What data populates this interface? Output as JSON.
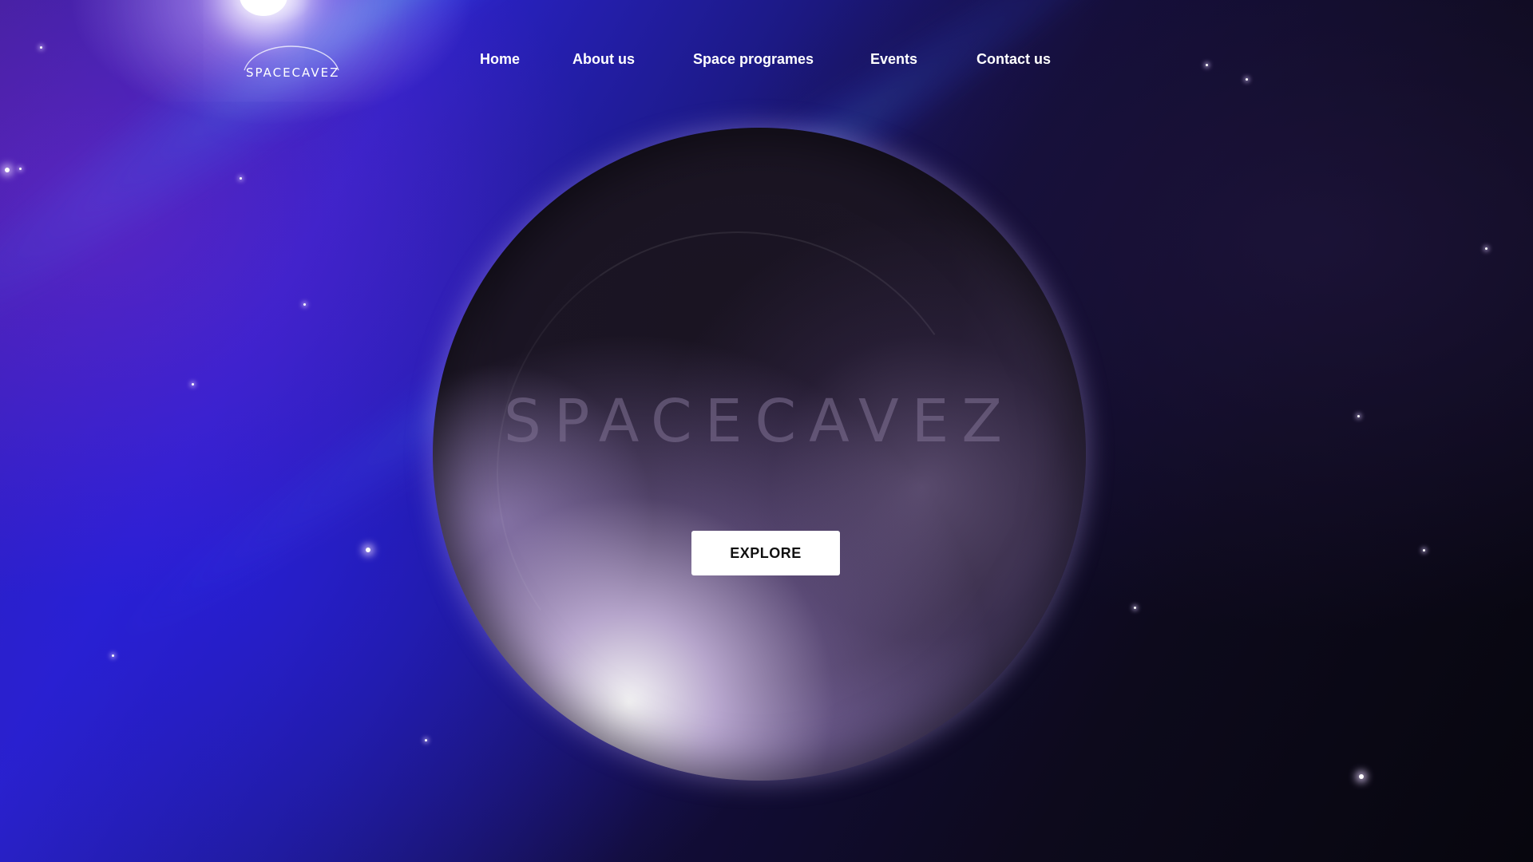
{
  "brand": {
    "logo_text": "SPACECAVEZ"
  },
  "nav": {
    "items": [
      {
        "label": "Home"
      },
      {
        "label": "About us"
      },
      {
        "label": "Space programes"
      },
      {
        "label": "Events"
      },
      {
        "label": "Contact us"
      }
    ]
  },
  "hero": {
    "title": "SPACECAVEZ",
    "cta_label": "EXPLORE"
  },
  "colors": {
    "background": "#0d0a1c",
    "nebula_blue": "#2a22c8",
    "nebula_purple": "#3a1f9a",
    "planet_highlight": "#e8ddff",
    "button_background": "#ffffff",
    "button_text": "#111111",
    "nav_text": "#ffffff"
  }
}
